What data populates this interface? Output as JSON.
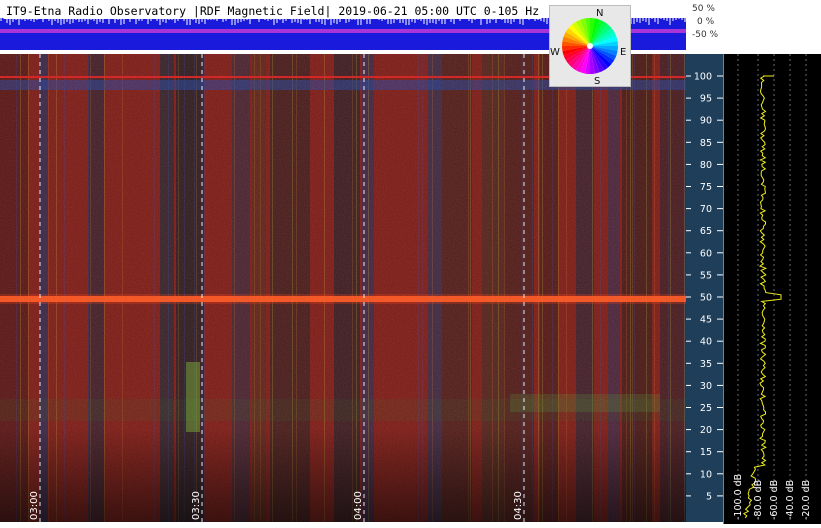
{
  "header": {
    "title": "IT9-Etna Radio Observatory |RDF Magnetic Field| 2019-06-21 05:00 UTC 0-105 Hz"
  },
  "amplitude_scale": [
    "50 %",
    "0 %",
    "-50 %"
  ],
  "compass": {
    "north": "N",
    "south": "S",
    "east": "E",
    "west": "W"
  },
  "time_axis": [
    "03:00",
    "03:30",
    "04:00",
    "04:30"
  ],
  "frequency_axis": [
    "100",
    "95",
    "90",
    "85",
    "80",
    "75",
    "70",
    "65",
    "60",
    "55",
    "50",
    "45",
    "40",
    "35",
    "30",
    "25",
    "20",
    "15",
    "10",
    "5"
  ],
  "power_axis": [
    "-100.0 dB",
    "-80.0 dB",
    "-60.0 dB",
    "-40.0 dB",
    "-20.0 dB"
  ],
  "colors": {
    "spectrogram_red": "#8a1a12",
    "line_50hz": "#ff5a1e",
    "band_blue": "#1f3f9a",
    "trace": "#f2ef1c",
    "axis_panel": "#1e3e5a"
  }
}
